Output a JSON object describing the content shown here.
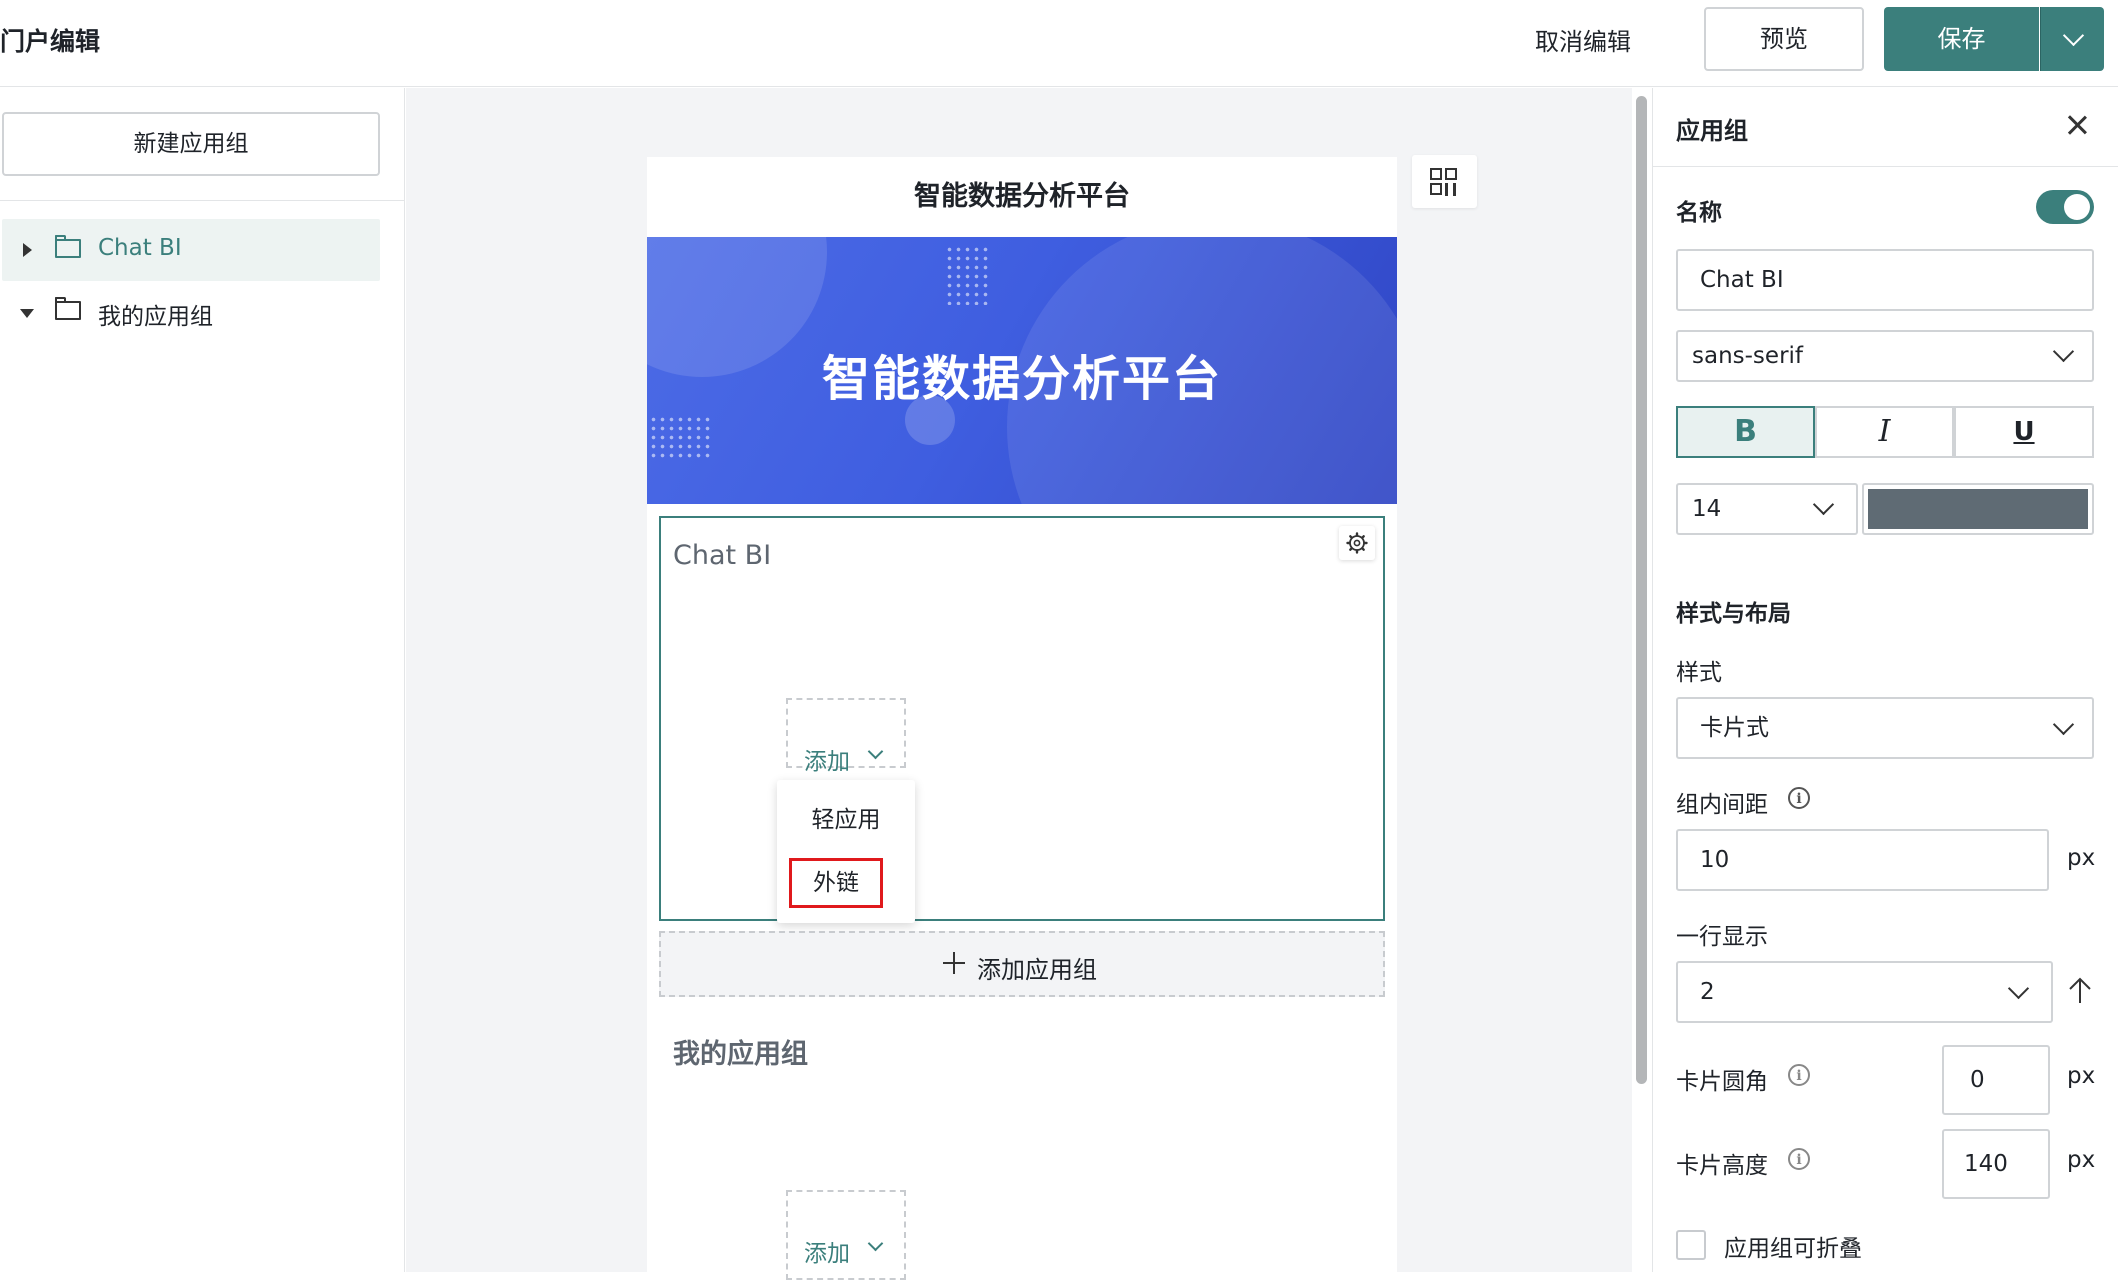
{
  "header": {
    "title": "门户编辑",
    "cancel_label": "取消编辑",
    "preview_label": "预览",
    "save_label": "保存"
  },
  "sidebar": {
    "new_group_label": "新建应用组",
    "items": [
      {
        "label": "Chat BI",
        "expanded": false,
        "selected": true
      },
      {
        "label": "我的应用组",
        "expanded": true,
        "selected": false
      }
    ]
  },
  "canvas": {
    "portal_title": "智能数据分析平台",
    "banner_title": "智能数据分析平台",
    "groups": [
      {
        "title": "Chat BI",
        "add_label": "添加"
      },
      {
        "title": "我的应用组",
        "add_label": "添加"
      }
    ],
    "add_menu": {
      "options": [
        "轻应用",
        "外链"
      ],
      "highlighted": "外链"
    },
    "add_group_label": "添加应用组"
  },
  "panel": {
    "title": "应用组",
    "name_label": "名称",
    "name_enabled": true,
    "name_value": "Chat BI",
    "font_value": "sans-serif",
    "format": {
      "bold": "B",
      "italic": "I",
      "underline": "U",
      "bold_active": true
    },
    "font_size": "14",
    "font_color": "#5f6b74",
    "style_section": "样式与布局",
    "style_label": "样式",
    "style_value": "卡片式",
    "gap_label": "组内间距",
    "gap_value": "10",
    "gap_unit": "px",
    "per_row_label": "一行显示",
    "per_row_value": "2",
    "radius_label": "卡片圆角",
    "radius_value": "0",
    "radius_unit": "px",
    "height_label": "卡片高度",
    "height_value": "140",
    "height_unit": "px",
    "collapsible_label": "应用组可折叠",
    "collapsible_checked": false
  },
  "colors": {
    "accent": "#3b7f7c",
    "highlight_border": "#e0191c",
    "banner": "#3f5ee0"
  }
}
